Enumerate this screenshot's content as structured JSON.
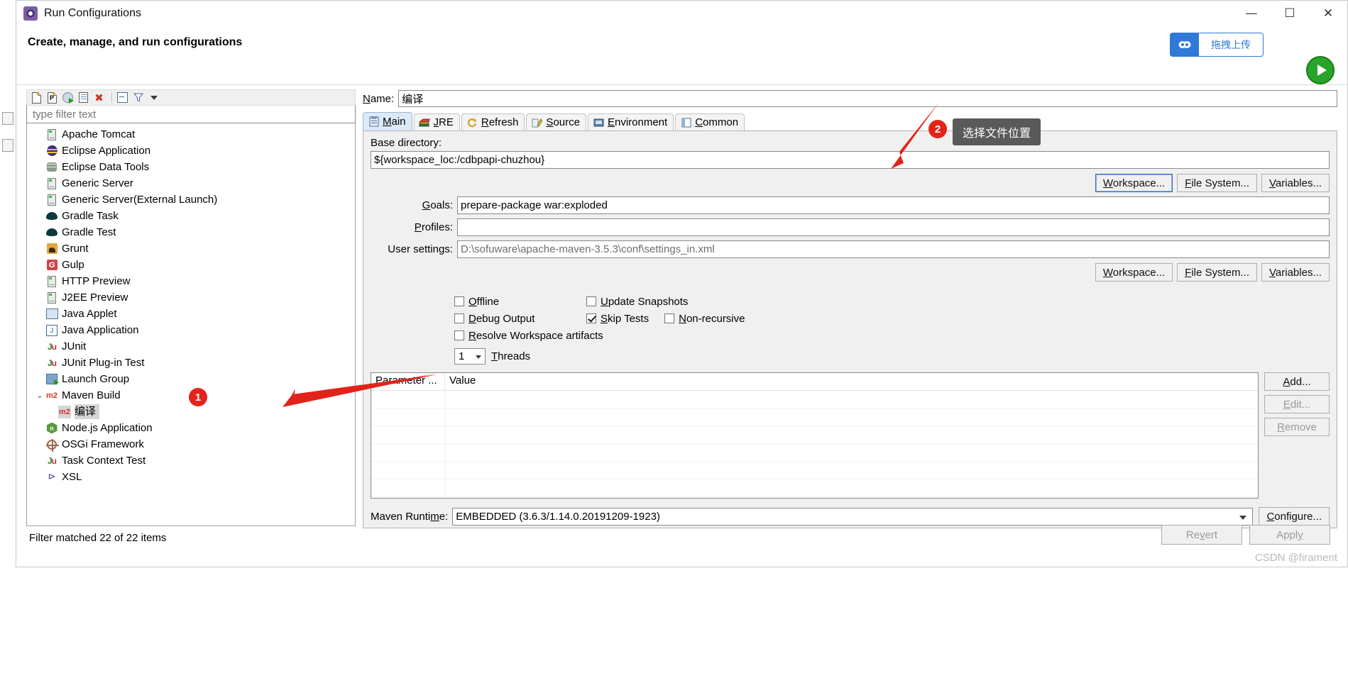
{
  "window": {
    "title": "Run Configurations",
    "title_icon": "gear-icon",
    "minimize": "—",
    "maximize": "☐",
    "close": "✕"
  },
  "header": {
    "subtitle": "Create, manage, and run configurations",
    "upload_badge_label": "拖拽上传",
    "upload_badge_icon": "cloud-upload-icon",
    "run_icon": "run-play-icon"
  },
  "left_panel": {
    "toolbar": [
      {
        "name": "new-configuration-icon",
        "title": "New launch configuration"
      },
      {
        "name": "new-prototype-icon",
        "title": "New prototype"
      },
      {
        "name": "new-launch-group-icon",
        "title": "New launch group"
      },
      {
        "name": "duplicate-icon",
        "title": "Duplicate"
      },
      {
        "name": "delete-icon",
        "title": "Delete"
      },
      {
        "name": "collapse-all-icon",
        "title": "Collapse All"
      },
      {
        "name": "filter-icon",
        "title": "Filter"
      },
      {
        "name": "view-menu-icon",
        "title": "View Menu"
      }
    ],
    "filter_placeholder": "type filter text",
    "filter_value": "",
    "tree": [
      {
        "label": "Apache Tomcat",
        "icon": "server-icon",
        "indent": 0
      },
      {
        "label": "Eclipse Application",
        "icon": "eclipse-icon",
        "indent": 0
      },
      {
        "label": "Eclipse Data Tools",
        "icon": "database-icon",
        "indent": 0
      },
      {
        "label": "Generic Server",
        "icon": "server-icon",
        "indent": 0
      },
      {
        "label": "Generic Server(External Launch)",
        "icon": "server-icon",
        "indent": 0
      },
      {
        "label": "Gradle Task",
        "icon": "gradle-icon",
        "indent": 0
      },
      {
        "label": "Gradle Test",
        "icon": "gradle-icon",
        "indent": 0
      },
      {
        "label": "Grunt",
        "icon": "grunt-icon",
        "indent": 0
      },
      {
        "label": "Gulp",
        "icon": "gulp-icon",
        "indent": 0
      },
      {
        "label": "HTTP Preview",
        "icon": "server-icon",
        "indent": 0
      },
      {
        "label": "J2EE Preview",
        "icon": "server-icon",
        "indent": 0
      },
      {
        "label": "Java Applet",
        "icon": "java-applet-icon",
        "indent": 0
      },
      {
        "label": "Java Application",
        "icon": "java-application-icon",
        "indent": 0
      },
      {
        "label": "JUnit",
        "icon": "junit-icon",
        "indent": 0
      },
      {
        "label": "JUnit Plug-in Test",
        "icon": "junit-plugin-icon",
        "indent": 0
      },
      {
        "label": "Launch Group",
        "icon": "launch-group-icon",
        "indent": 0
      },
      {
        "label": "Maven Build",
        "icon": "maven-icon",
        "indent": 0,
        "expanded": true
      },
      {
        "label": "编译",
        "icon": "maven-icon",
        "indent": 1,
        "selected": true
      },
      {
        "label": "Node.js Application",
        "icon": "nodejs-icon",
        "indent": 0
      },
      {
        "label": "OSGi Framework",
        "icon": "osgi-icon",
        "indent": 0
      },
      {
        "label": "Task Context Test",
        "icon": "junit-icon",
        "indent": 0
      },
      {
        "label": "XSL",
        "icon": "xsl-icon",
        "indent": 0
      }
    ],
    "status": "Filter matched 22 of 22 items"
  },
  "right_panel": {
    "name_label": "Name:",
    "name_label_mnemonic": "N",
    "name_value": "编译",
    "tabs": [
      {
        "label": "Main",
        "icon": "main-tab-icon",
        "active": true,
        "mnemonic": "M"
      },
      {
        "label": "JRE",
        "icon": "jre-tab-icon",
        "active": false,
        "mnemonic": "J"
      },
      {
        "label": "Refresh",
        "icon": "refresh-tab-icon",
        "active": false,
        "mnemonic": "R"
      },
      {
        "label": "Source",
        "icon": "source-tab-icon",
        "active": false,
        "mnemonic": "S"
      },
      {
        "label": "Environment",
        "icon": "environment-tab-icon",
        "active": false,
        "mnemonic": "E"
      },
      {
        "label": "Common",
        "icon": "common-tab-icon",
        "active": false,
        "mnemonic": "C"
      }
    ],
    "base_directory": {
      "label": "Base directory:",
      "value": "${workspace_loc:/cdbpapi-chuzhou}",
      "buttons": [
        {
          "label": "Workspace...",
          "mnemonic": "W",
          "focused": true
        },
        {
          "label": "File System...",
          "mnemonic": "F"
        },
        {
          "label": "Variables...",
          "mnemonic": "V"
        }
      ]
    },
    "goals": {
      "label": "Goals:",
      "mnemonic": "G",
      "value": "prepare-package war:exploded"
    },
    "profiles": {
      "label": "Profiles:",
      "mnemonic": "P",
      "value": ""
    },
    "user_settings": {
      "label": "User settings:",
      "value": "D:\\sofuware\\apache-maven-3.5.3\\conf\\settings_in.xml",
      "buttons": [
        {
          "label": "Workspace...",
          "mnemonic": "W"
        },
        {
          "label": "File System...",
          "mnemonic": "F"
        },
        {
          "label": "Variables...",
          "mnemonic": "V"
        }
      ]
    },
    "checkboxes": [
      {
        "label": "Offline",
        "mnemonic": "O",
        "checked": false
      },
      {
        "label": "Update Snapshots",
        "mnemonic": "U",
        "checked": false
      },
      {
        "label": "Debug Output",
        "mnemonic": "D",
        "checked": false
      },
      {
        "label": "Skip Tests",
        "mnemonic": "S",
        "checked": true
      },
      {
        "label": "Non-recursive",
        "mnemonic": "N",
        "checked": false
      },
      {
        "label": "Resolve Workspace artifacts",
        "mnemonic": "R",
        "checked": false
      }
    ],
    "threads": {
      "value": "1",
      "label": "Threads",
      "mnemonic": "T"
    },
    "parameters_table": {
      "columns": [
        "Parameter ...",
        "Value"
      ],
      "rows": [],
      "empty_row_count": 7
    },
    "table_buttons": [
      {
        "label": "Add...",
        "mnemonic": "A",
        "enabled": true
      },
      {
        "label": "Edit...",
        "mnemonic": "E",
        "enabled": false
      },
      {
        "label": "Remove",
        "mnemonic": "R",
        "enabled": false
      }
    ],
    "maven_runtime": {
      "label": "Maven Runtime:",
      "mnemonic": "m",
      "value": "EMBEDDED (3.6.3/1.14.0.20191209-1923)",
      "configure_button": {
        "label": "Configure...",
        "mnemonic": "C"
      }
    },
    "bottom_buttons": [
      {
        "label": "Revert",
        "mnemonic": "v",
        "enabled": false
      },
      {
        "label": "Apply",
        "mnemonic": "y",
        "enabled": false
      }
    ]
  },
  "annotations": [
    {
      "badge": "1",
      "text": ""
    },
    {
      "badge": "2",
      "text": "选择文件位置"
    }
  ],
  "watermark": "CSDN @firament",
  "colors": {
    "accent_blue": "#2f7ad6",
    "annotation_red": "#e2231a",
    "tooltip_bg": "#5a5a5a",
    "run_green": "#2aa32a",
    "selection_grey": "#d6d6d6"
  }
}
